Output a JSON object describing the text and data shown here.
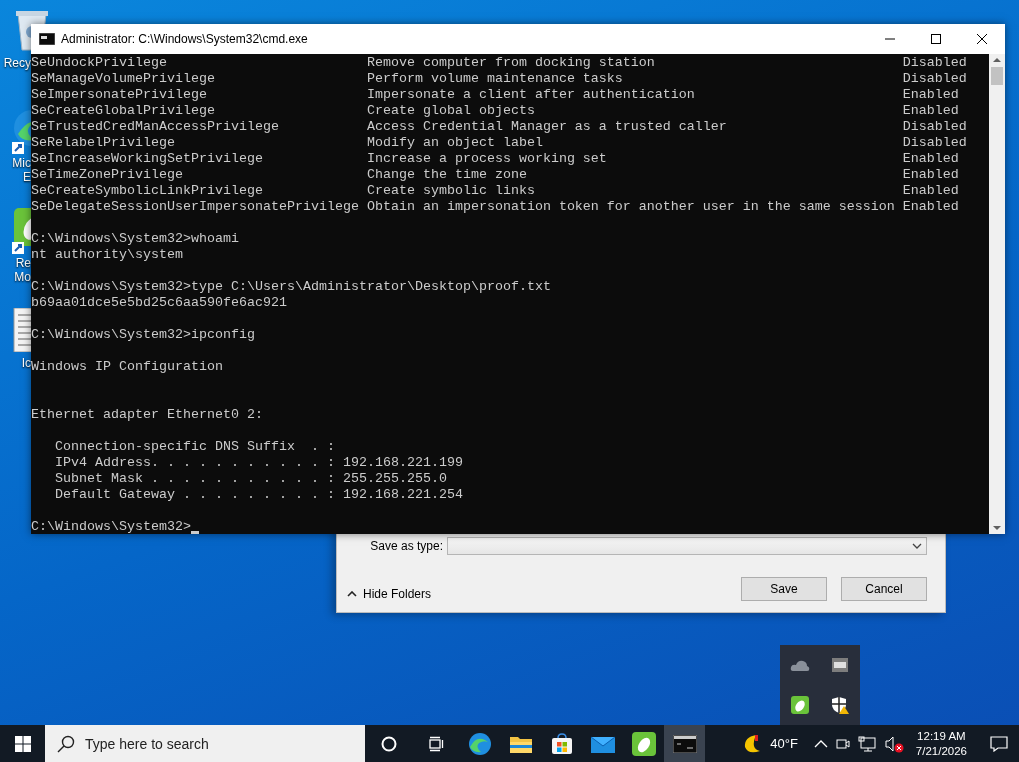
{
  "desktop_icons": [
    {
      "kind": "recycle-bin",
      "label_lines": [
        "Recy"
      ]
    },
    {
      "kind": "edge",
      "label_lines": [
        "Mic",
        "E"
      ]
    },
    {
      "kind": "mouse",
      "label_lines": [
        "Re",
        "Mo"
      ]
    },
    {
      "kind": "document",
      "label_lines": [
        "Ic"
      ]
    }
  ],
  "console_window": {
    "title": "Administrator: C:\\Windows\\System32\\cmd.exe",
    "privileges": [
      {
        "name": "SeUndockPrivilege",
        "description": "Remove computer from docking station",
        "state": "Disabled"
      },
      {
        "name": "SeManageVolumePrivilege",
        "description": "Perform volume maintenance tasks",
        "state": "Disabled"
      },
      {
        "name": "SeImpersonatePrivilege",
        "description": "Impersonate a client after authentication",
        "state": "Enabled"
      },
      {
        "name": "SeCreateGlobalPrivilege",
        "description": "Create global objects",
        "state": "Enabled"
      },
      {
        "name": "SeTrustedCredManAccessPrivilege",
        "description": "Access Credential Manager as a trusted caller",
        "state": "Disabled"
      },
      {
        "name": "SeRelabelPrivilege",
        "description": "Modify an object label",
        "state": "Disabled"
      },
      {
        "name": "SeIncreaseWorkingSetPrivilege",
        "description": "Increase a process working set",
        "state": "Enabled"
      },
      {
        "name": "SeTimeZonePrivilege",
        "description": "Change the time zone",
        "state": "Enabled"
      },
      {
        "name": "SeCreateSymbolicLinkPrivilege",
        "description": "Create symbolic links",
        "state": "Enabled"
      },
      {
        "name": "SeDelegateSessionUserImpersonatePrivilege",
        "description": "Obtain an impersonation token for another user in the same session",
        "state": "Enabled"
      }
    ],
    "blocks": [
      {
        "kind": "output",
        "lines": [
          "C:\\Windows\\System32>whoami",
          "nt authority\\system"
        ]
      },
      {
        "kind": "output",
        "lines": [
          "C:\\Windows\\System32>type C:\\Users\\Administrator\\Desktop\\proof.txt",
          "b69aa01dce5e5bd25c6aa590fe6ac921"
        ]
      },
      {
        "kind": "output",
        "lines": [
          "C:\\Windows\\System32>ipconfig"
        ]
      },
      {
        "kind": "heading",
        "lines": [
          "Windows IP Configuration"
        ]
      },
      {
        "kind": "output",
        "lines": [
          "Ethernet adapter Ethernet0 2:"
        ]
      },
      {
        "kind": "output",
        "lines": [
          "   Connection-specific DNS Suffix  . :",
          "   IPv4 Address. . . . . . . . . . . : 192.168.221.199",
          "   Subnet Mask . . . . . . . . . . . : 255.255.255.0",
          "   Default Gateway . . . . . . . . . : 192.168.221.254"
        ]
      }
    ],
    "prompt": "C:\\Windows\\System32>"
  },
  "save_dialog": {
    "type_label": "Save as type:",
    "hide_folders": "Hide Folders",
    "buttons": [
      "Save",
      "Cancel"
    ]
  },
  "tray_overflow": [
    {
      "kind": "cloud"
    },
    {
      "kind": "vm"
    },
    {
      "kind": "mouse"
    },
    {
      "kind": "shield"
    }
  ],
  "taskbar": {
    "search_placeholder": "Type here to search",
    "apps": [
      {
        "kind": "cortana",
        "selected": false
      },
      {
        "kind": "task-view",
        "selected": false
      },
      {
        "kind": "edge",
        "selected": false
      },
      {
        "kind": "explorer",
        "selected": false
      },
      {
        "kind": "store",
        "selected": false
      },
      {
        "kind": "mail",
        "selected": false
      },
      {
        "kind": "mouse",
        "selected": false
      },
      {
        "kind": "cmd",
        "selected": true
      }
    ],
    "weather": "40°F",
    "volume_muted": true,
    "time": "12:19 AM",
    "date": "7/21/2026"
  }
}
